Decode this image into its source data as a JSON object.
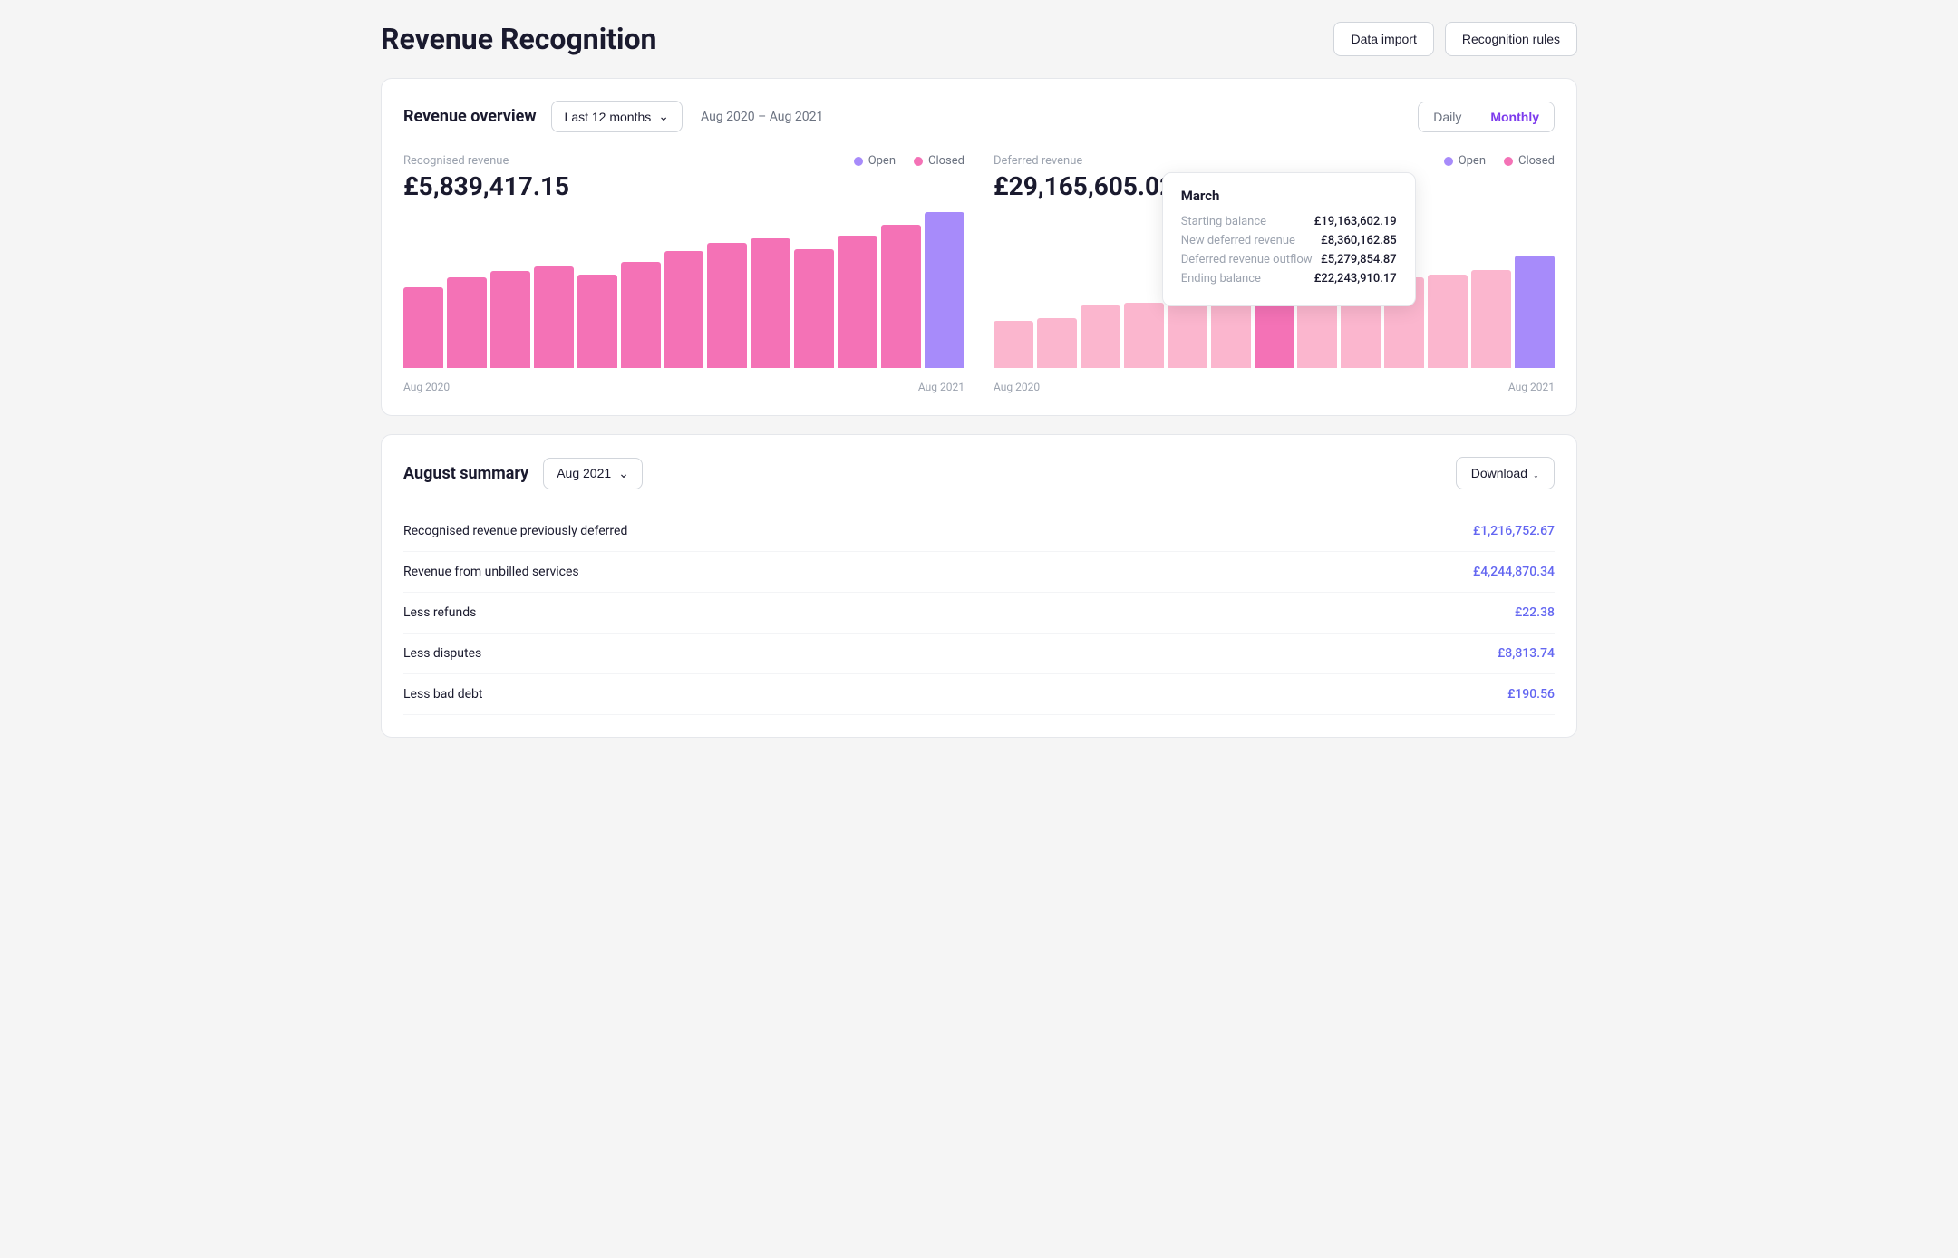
{
  "page": {
    "title": "Revenue Recognition"
  },
  "header": {
    "data_import_label": "Data import",
    "recognition_rules_label": "Recognition rules"
  },
  "revenue_overview": {
    "section_title": "Revenue overview",
    "date_filter": "Last 12 months",
    "date_range": "Aug 2020 – Aug 2021",
    "toggle_daily": "Daily",
    "toggle_monthly": "Monthly",
    "recognised": {
      "label": "Recognised revenue",
      "value": "£5,839,417.15",
      "legend_open": "Open",
      "legend_closed": "Closed"
    },
    "deferred": {
      "label": "Deferred revenue",
      "value": "£29,165,605.02",
      "legend_open": "Open",
      "legend_closed": "Closed"
    },
    "tooltip": {
      "title": "March",
      "rows": [
        {
          "label": "Starting balance",
          "value": "£19,163,602.19"
        },
        {
          "label": "New deferred revenue",
          "value": "£8,360,162.85"
        },
        {
          "label": "Deferred revenue outflow",
          "value": "£5,279,854.87"
        },
        {
          "label": "Ending balance",
          "value": "£22,243,910.17"
        }
      ]
    },
    "chart_start_label": "Aug 2020",
    "chart_end_label": "Aug 2021",
    "colors": {
      "open": "#a78bfa",
      "closed": "#f472b6",
      "closed_light": "#fbb6ce"
    }
  },
  "august_summary": {
    "section_title": "August summary",
    "month_selector": "Aug 2021",
    "download_label": "Download",
    "rows": [
      {
        "label": "Recognised revenue previously deferred",
        "value": "£1,216,752.67"
      },
      {
        "label": "Revenue from unbilled services",
        "value": "£4,244,870.34"
      },
      {
        "label": "Less refunds",
        "value": "£22.38"
      },
      {
        "label": "Less disputes",
        "value": "£8,813.74"
      },
      {
        "label": "Less bad debt",
        "value": "£190.56"
      }
    ]
  }
}
